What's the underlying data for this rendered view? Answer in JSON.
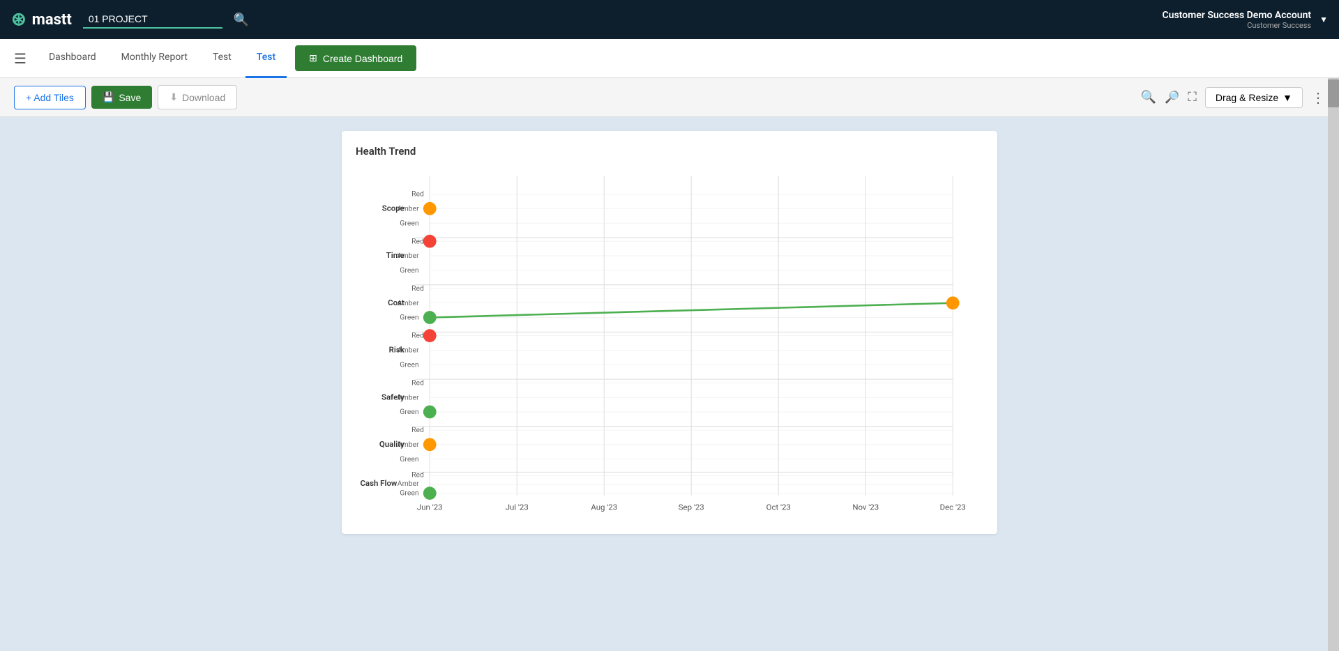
{
  "topNav": {
    "logo": "mastt",
    "project": "01 PROJECT",
    "accountName": "Customer Success Demo Account",
    "accountSub": "Customer Success"
  },
  "subNav": {
    "tabs": [
      {
        "id": "dashboard",
        "label": "Dashboard",
        "active": false
      },
      {
        "id": "monthly-report",
        "label": "Monthly Report",
        "active": false
      },
      {
        "id": "test1",
        "label": "Test",
        "active": false
      },
      {
        "id": "test2",
        "label": "Test",
        "active": true
      }
    ],
    "createDashboard": "Create Dashboard"
  },
  "toolbar": {
    "addTiles": "+ Add Tiles",
    "save": "Save",
    "download": "Download",
    "dragResize": "Drag & Resize"
  },
  "chart": {
    "title": "Health Trend",
    "xLabels": [
      "Jun '23",
      "Jul '23",
      "Aug '23",
      "Sep '23",
      "Oct '23",
      "Nov '23",
      "Dec '23"
    ],
    "yCategories": [
      {
        "name": "Scope",
        "levels": [
          "Red",
          "Amber",
          "Green"
        ]
      },
      {
        "name": "Time",
        "levels": [
          "Red",
          "Amber",
          "Green"
        ]
      },
      {
        "name": "Cost",
        "levels": [
          "Red",
          "Amber",
          "Green"
        ]
      },
      {
        "name": "Risk",
        "levels": [
          "Red",
          "Amber",
          "Green"
        ]
      },
      {
        "name": "Safety",
        "levels": [
          "Red",
          "Amber",
          "Green"
        ]
      },
      {
        "name": "Quality",
        "levels": [
          "Red",
          "Amber",
          "Green"
        ]
      },
      {
        "name": "Cash Flow",
        "levels": [
          "Red",
          "Amber",
          "Green"
        ]
      }
    ],
    "dataPoints": [
      {
        "category": "Scope",
        "level": "Amber",
        "xIndex": 0,
        "color": "#FF9800"
      },
      {
        "category": "Time",
        "level": "Red",
        "xIndex": 0,
        "color": "#f44336"
      },
      {
        "category": "Cost",
        "level": "Green",
        "xIndex": 0,
        "color": "#4caf50"
      },
      {
        "category": "Cost",
        "level": "Amber",
        "xIndex": 6,
        "color": "#FF9800"
      },
      {
        "category": "Risk",
        "level": "Red",
        "xIndex": 0,
        "color": "#f44336"
      },
      {
        "category": "Safety",
        "level": "Green",
        "xIndex": 0,
        "color": "#4caf50"
      },
      {
        "category": "Quality",
        "level": "Amber",
        "xIndex": 0,
        "color": "#FF9800"
      },
      {
        "category": "Cash Flow",
        "level": "Green",
        "xIndex": 0,
        "color": "#4caf50"
      }
    ]
  }
}
